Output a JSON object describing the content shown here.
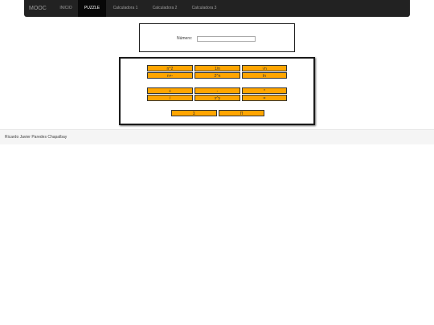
{
  "navbar": {
    "brand": "MOOC",
    "items": [
      {
        "label": "INICIO"
      },
      {
        "label": "PUZZLE",
        "active": true
      },
      {
        "label": "Calculadora 1"
      },
      {
        "label": "Calculadora 2"
      },
      {
        "label": "Calculadora 3"
      }
    ]
  },
  "number": {
    "label": "Número:",
    "value": "",
    "placeholder": ""
  },
  "calculator": {
    "row1": [
      "n^2",
      "1/n",
      "√n"
    ],
    "row2": [
      "n+-",
      "2^n",
      "ln"
    ],
    "row3": [
      "+",
      "-",
      "*"
    ],
    "row4": [
      "/",
      "x^y",
      "="
    ],
    "row5": [
      "Σ",
      "Π"
    ]
  },
  "footer": {
    "text": "Ricardo Javier Paredes Chapalbay"
  },
  "colors": {
    "navbar_bg": "#222222",
    "button_bg": "#ffa500"
  }
}
